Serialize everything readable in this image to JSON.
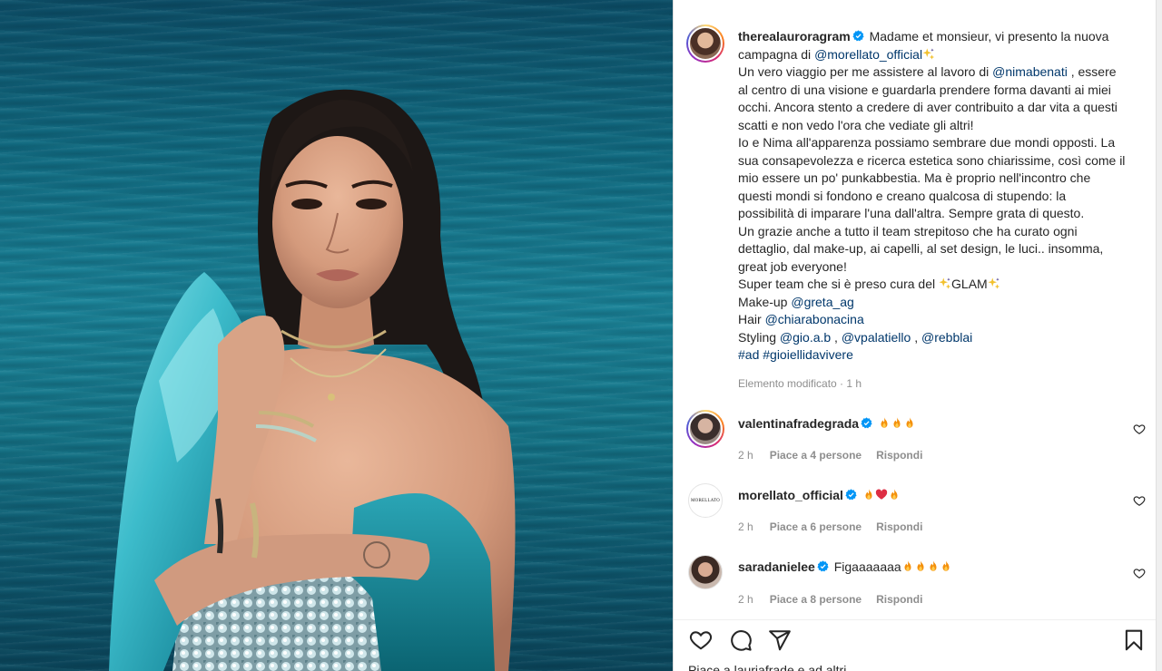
{
  "post": {
    "author": "therealauroragram",
    "caption_lines": [
      {
        "parts": [
          {
            "t": "Madame et monsieur, vi presento la nuova"
          }
        ]
      },
      {
        "parts": [
          {
            "t": "campagna di "
          },
          {
            "t": "@morellato_official",
            "m": true
          },
          {
            "e": "sparkle"
          }
        ]
      },
      {
        "parts": [
          {
            "t": "Un vero viaggio per me assistere al lavoro di "
          },
          {
            "t": "@nimabenati",
            "m": true
          },
          {
            "t": " , essere"
          }
        ]
      },
      {
        "parts": [
          {
            "t": "al centro di una visione e guardarla prendere forma davanti ai miei"
          }
        ]
      },
      {
        "parts": [
          {
            "t": "occhi. Ancora stento a credere di aver contribuito a dar vita a questi"
          }
        ]
      },
      {
        "parts": [
          {
            "t": "scatti e non vedo l'ora che vediate gli altri!"
          }
        ]
      },
      {
        "parts": [
          {
            "t": "Io e Nima all'apparenza possiamo sembrare due mondi opposti. La"
          }
        ]
      },
      {
        "parts": [
          {
            "t": "sua consapevolezza e ricerca estetica sono chiarissime, così come il"
          }
        ]
      },
      {
        "parts": [
          {
            "t": "mio essere un po' punkabbestia. Ma è proprio nell'incontro che"
          }
        ]
      },
      {
        "parts": [
          {
            "t": "questi mondi si fondono e creano qualcosa di stupendo: la"
          }
        ]
      },
      {
        "parts": [
          {
            "t": "possibilità di imparare l'una dall'altra. Sempre grata di questo."
          }
        ]
      },
      {
        "parts": [
          {
            "t": "Un grazie anche a tutto il team strepitoso che ha curato ogni"
          }
        ]
      },
      {
        "parts": [
          {
            "t": "dettaglio, dal make-up, ai capelli, al set design, le luci.. insomma,"
          }
        ]
      },
      {
        "parts": [
          {
            "t": "great job everyone!"
          }
        ]
      },
      {
        "parts": [
          {
            "t": "Super team che si è preso cura del "
          },
          {
            "e": "sparkle"
          },
          {
            "t": "GLAM"
          },
          {
            "e": "sparkle"
          }
        ]
      },
      {
        "parts": [
          {
            "t": "Make-up "
          },
          {
            "t": "@greta_ag",
            "m": true
          }
        ]
      },
      {
        "parts": [
          {
            "t": "Hair "
          },
          {
            "t": "@chiarabonacina",
            "m": true
          }
        ]
      },
      {
        "parts": [
          {
            "t": "Styling "
          },
          {
            "t": "@gio.a.b",
            "m": true
          },
          {
            "t": " , "
          },
          {
            "t": "@vpalatiello",
            "m": true
          },
          {
            "t": " , "
          },
          {
            "t": "@rebblai",
            "m": true
          }
        ]
      },
      {
        "parts": [
          {
            "t": "#ad",
            "m": true
          },
          {
            "t": " "
          },
          {
            "t": "#gioiellidavivere",
            "m": true
          }
        ]
      }
    ],
    "edited_label": "Elemento modificato · 1 h"
  },
  "comments": [
    {
      "user": "valentinafradegrada",
      "verified": true,
      "text": "",
      "emojis": [
        "fire",
        "fire",
        "fire"
      ],
      "time": "2 h",
      "likes": "Piace a 4 persone",
      "reply": "Rispondi"
    },
    {
      "user": "morellato_official",
      "verified": true,
      "text": "",
      "emojis": [
        "fire",
        "heart",
        "fire"
      ],
      "time": "2 h",
      "likes": "Piace a 6 persone",
      "reply": "Rispondi",
      "avatar_text": "MORELLATO"
    },
    {
      "user": "saradanielee",
      "verified": true,
      "text": "Figaaaaaaa",
      "emojis": [
        "fire",
        "fire",
        "fire",
        "fire"
      ],
      "time": "2 h",
      "likes": "Piace a 8 persone",
      "reply": "Rispondi"
    }
  ],
  "icons": {
    "like": "heart-outline-icon",
    "comment": "speech-bubble-icon",
    "share": "paper-plane-icon",
    "save": "bookmark-icon",
    "verified": "verified-badge-icon",
    "comment_like": "small-heart-icon"
  },
  "colors": {
    "link": "#00376b",
    "muted": "#8e8e8e",
    "verified": "#0095f6",
    "text": "#262626"
  },
  "footer": {
    "likes_peek": "Piace a lauriafrade e ad altri"
  }
}
